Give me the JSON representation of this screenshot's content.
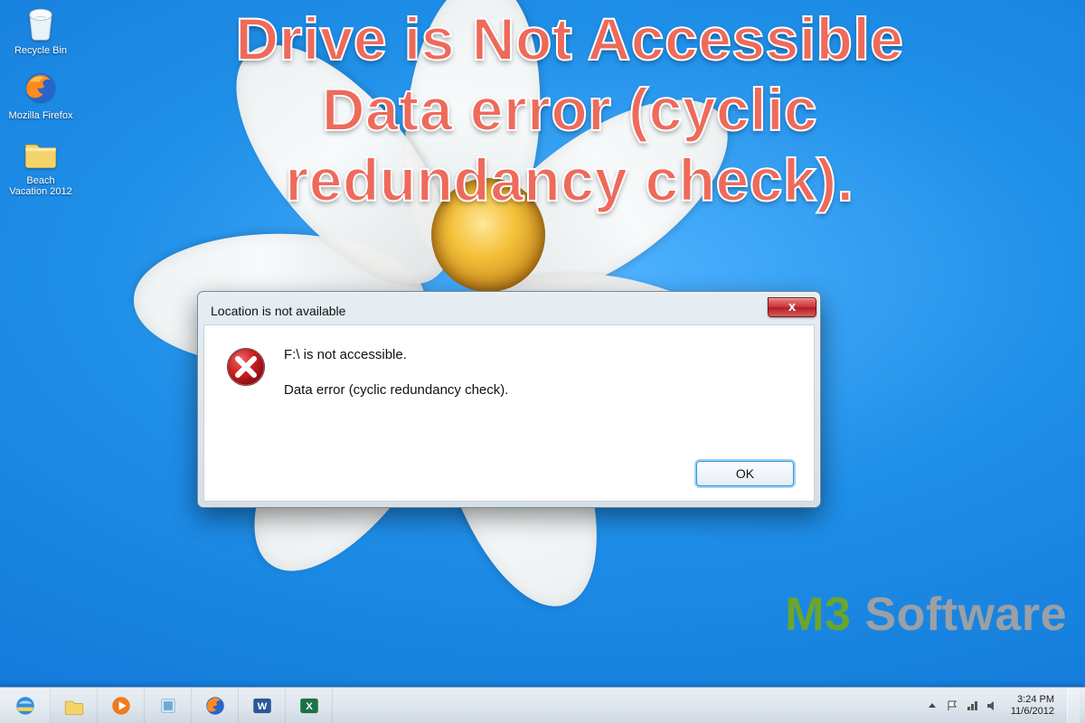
{
  "headline": {
    "line1": "Drive is Not Accessible",
    "line2": "Data error (cyclic",
    "line3": "redundancy check)."
  },
  "desktop_icons": [
    {
      "name": "recycle-bin-icon",
      "label": "Recycle Bin"
    },
    {
      "name": "firefox-icon",
      "label": "Mozilla Firefox"
    },
    {
      "name": "folder-icon",
      "label": "Beach Vacation 2012"
    }
  ],
  "dialog": {
    "title": "Location is not available",
    "msg_line1": "F:\\ is not accessible.",
    "msg_line2": "Data error (cyclic redundancy check).",
    "ok_label": "OK",
    "close_label": "x"
  },
  "brand": {
    "m3": "M3",
    "space": " ",
    "software": "Software"
  },
  "taskbar": {
    "pins": [
      {
        "name": "ie-icon"
      },
      {
        "name": "explorer-icon"
      },
      {
        "name": "mediaplayer-icon"
      },
      {
        "name": "libraries-icon"
      },
      {
        "name": "firefox-taskbar-icon"
      },
      {
        "name": "word-icon"
      },
      {
        "name": "excel-icon"
      }
    ],
    "tray": {
      "time": "3:24 PM",
      "date": "11/6/2012"
    }
  }
}
